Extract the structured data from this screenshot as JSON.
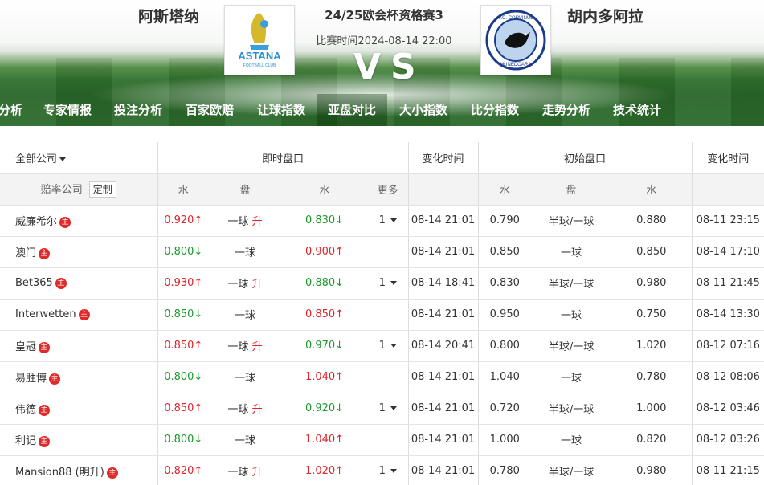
{
  "match": {
    "home_team": "阿斯塔纳",
    "away_team": "胡内多阿拉",
    "title": "24/25欧会杯资格赛3",
    "time": "比赛时间2024-08-14 22:00",
    "vs": "VS",
    "home_logo_text": "ASTANA",
    "home_logo_sub": "FOOTBALL CLUB",
    "away_logo_text_top": "F.C. CORVINUL",
    "away_logo_text_bottom": "HUNEDOARA"
  },
  "nav": {
    "items": [
      "分析",
      "专家情报",
      "投注分析",
      "百家欧赔",
      "让球指数",
      "亚盘对比",
      "大小指数",
      "比分指数",
      "走势分析",
      "技术统计"
    ],
    "active_index": 5
  },
  "table": {
    "company_filter": "全部公司",
    "live_header": "即时盘口",
    "change_time_header": "变化时间",
    "initial_header": "初始盘口",
    "company_col": "赔率公司",
    "custom_button": "定制",
    "water_label": "水",
    "handicap_label": "盘",
    "more_label": "更多",
    "rise_label": "升",
    "main_badge": "主",
    "rows": [
      {
        "company": "威廉希尔",
        "w1": "0.920↑",
        "w1c": "red",
        "pan": "一球",
        "rise": true,
        "w2": "0.830↓",
        "w2c": "green",
        "more": "1",
        "time": "08-14 21:01",
        "iw1": "0.790",
        "ipan": "半球/一球",
        "iw2": "0.880",
        "itime": "08-11 23:15"
      },
      {
        "company": "澳门",
        "w1": "0.800↓",
        "w1c": "green",
        "pan": "一球",
        "rise": false,
        "w2": "0.900↑",
        "w2c": "red",
        "more": "",
        "time": "08-14 21:01",
        "iw1": "0.850",
        "ipan": "一球",
        "iw2": "0.850",
        "itime": "08-14 17:10"
      },
      {
        "company": "Bet365",
        "w1": "0.930↑",
        "w1c": "red",
        "pan": "一球",
        "rise": true,
        "w2": "0.880↓",
        "w2c": "green",
        "more": "1",
        "time": "08-14 18:41",
        "iw1": "0.830",
        "ipan": "半球/一球",
        "iw2": "0.980",
        "itime": "08-11 21:45"
      },
      {
        "company": "Interwetten",
        "w1": "0.850↓",
        "w1c": "green",
        "pan": "一球",
        "rise": false,
        "w2": "0.850↑",
        "w2c": "red",
        "more": "",
        "time": "08-14 21:01",
        "iw1": "0.950",
        "ipan": "一球",
        "iw2": "0.750",
        "itime": "08-14 13:30"
      },
      {
        "company": "皇冠",
        "w1": "0.850↑",
        "w1c": "red",
        "pan": "一球",
        "rise": true,
        "w2": "0.970↓",
        "w2c": "green",
        "more": "1",
        "time": "08-14 20:41",
        "iw1": "0.800",
        "ipan": "半球/一球",
        "iw2": "1.020",
        "itime": "08-12 07:16"
      },
      {
        "company": "易胜博",
        "w1": "0.800↓",
        "w1c": "green",
        "pan": "一球",
        "rise": false,
        "w2": "1.040↑",
        "w2c": "red",
        "more": "",
        "time": "08-14 21:01",
        "iw1": "1.040",
        "ipan": "一球",
        "iw2": "0.780",
        "itime": "08-12 08:06"
      },
      {
        "company": "伟德",
        "w1": "0.850↑",
        "w1c": "red",
        "pan": "一球",
        "rise": true,
        "w2": "0.920↓",
        "w2c": "green",
        "more": "1",
        "time": "08-14 21:01",
        "iw1": "0.720",
        "ipan": "半球/一球",
        "iw2": "1.000",
        "itime": "08-12 03:46"
      },
      {
        "company": "利记",
        "w1": "0.800↓",
        "w1c": "green",
        "pan": "一球",
        "rise": false,
        "w2": "1.040↑",
        "w2c": "red",
        "more": "",
        "time": "08-14 21:01",
        "iw1": "1.000",
        "ipan": "一球",
        "iw2": "0.820",
        "itime": "08-12 03:26"
      },
      {
        "company": "Mansion88 (明升)",
        "w1": "0.820↑",
        "w1c": "red",
        "pan": "一球",
        "rise": true,
        "w2": "1.020↑",
        "w2c": "red",
        "more": "1",
        "time": "08-14 21:01",
        "iw1": "0.780",
        "ipan": "半球/一球",
        "iw2": "0.980",
        "itime": "08-11 21:15"
      }
    ]
  },
  "colors": {
    "up": "#e0242a",
    "down": "#1a9a2a",
    "pitch": "#2f6f2b",
    "badge": "#e02a2a"
  }
}
